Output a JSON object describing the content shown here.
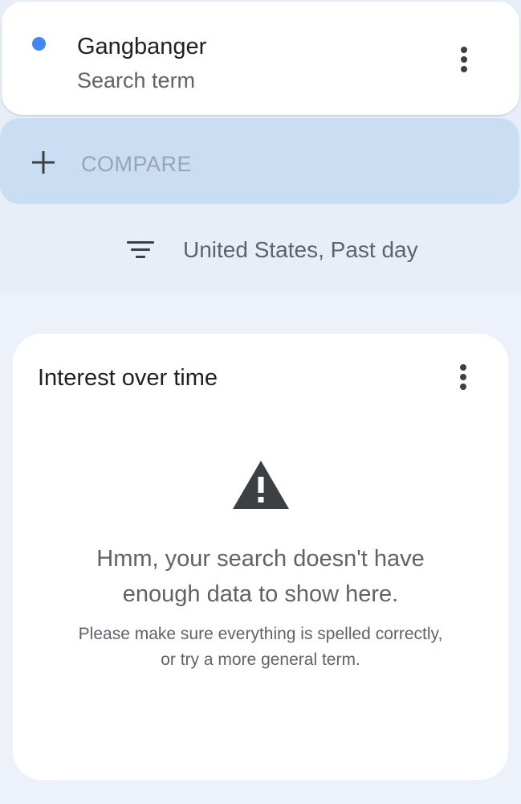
{
  "colors": {
    "background": "#edf2fa",
    "term_dot": "#4285f4",
    "compare_bar": "#c9def3",
    "icon_dark": "#3c4043",
    "warning_icon": "#3c4043"
  },
  "search_term": {
    "name": "Gangbanger",
    "type_label": "Search term",
    "more_icon": "more-vert-icon"
  },
  "compare": {
    "icon": "plus-icon",
    "label": "COMPARE"
  },
  "filter": {
    "icon": "filter-list-icon",
    "label": "United States, Past day"
  },
  "interest_card": {
    "title": "Interest over time",
    "more_icon": "more-vert-icon",
    "warning_icon": "warning-triangle-icon",
    "message_lines": [
      "Hmm, your search doesn't have",
      "enough data to show here."
    ],
    "hint_lines": [
      "Please make sure everything is spelled correctly,",
      "or try a more general term."
    ]
  }
}
